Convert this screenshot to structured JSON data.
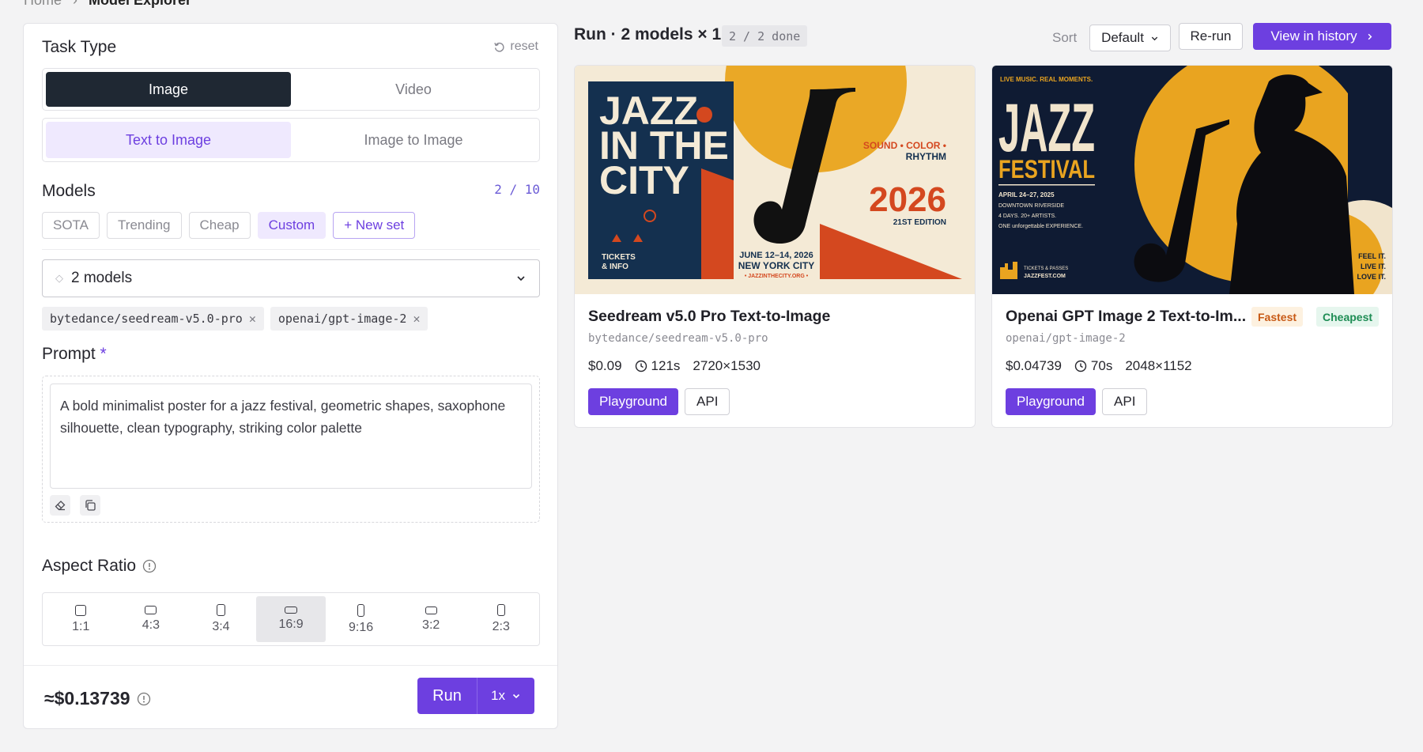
{
  "breadcrumb": {
    "home": "Home",
    "separator": "›",
    "current": "Model Explorer"
  },
  "task": {
    "title": "Task Type",
    "reset": "reset",
    "types": [
      "Image",
      "Video"
    ],
    "modes": [
      "Text to Image",
      "Image to Image"
    ]
  },
  "models": {
    "title": "Models",
    "counter": "2 / 10",
    "presets": [
      "SOTA",
      "Trending",
      "Cheap",
      "Custom",
      "+ New set"
    ],
    "select_label": "2 models",
    "selected": [
      "bytedance/seedream-v5.0-pro",
      "openai/gpt-image-2"
    ]
  },
  "prompt": {
    "title": "Prompt",
    "required": "*",
    "text": "A bold minimalist poster for a jazz festival, geometric shapes, saxophone silhouette, clean typography, striking color palette"
  },
  "aspect": {
    "title": "Aspect Ratio",
    "options": [
      "1:1",
      "4:3",
      "3:4",
      "16:9",
      "9:16",
      "3:2",
      "2:3"
    ],
    "selected": "16:9"
  },
  "footer": {
    "cost": "≈$0.13739",
    "run": "Run",
    "multiplier": "1x"
  },
  "run": {
    "title": "Run · 2 models × 1",
    "status": "2 / 2 done",
    "sort_label": "Sort",
    "sort_value": "Default",
    "rerun": "Re-run",
    "history": "View in history"
  },
  "results": [
    {
      "name": "Seedream v5.0 Pro Text-to-Image",
      "id": "bytedance/seedream-v5.0-pro",
      "price": "$0.09",
      "duration": "121s",
      "resolution": "2720×1530",
      "playground": "Playground",
      "api": "API",
      "poster": {
        "line1": "JAZZ",
        "line2": "IN THE",
        "line3": "CITY",
        "tickets1": "TICKETS",
        "tickets2": "& INFO",
        "tagline1": "SOUND • COLOR •",
        "tagline2": "RHYTHM",
        "year": "2026",
        "edition": "21ST EDITION",
        "date": "JUNE 12–14, 2026",
        "city": "NEW YORK CITY",
        "url": "• JAZZINTHECITY.ORG •"
      }
    },
    {
      "name": "Openai GPT Image 2 Text-to-Im...",
      "id": "openai/gpt-image-2",
      "price": "$0.04739",
      "duration": "70s",
      "resolution": "2048×1152",
      "badges": [
        "Fastest",
        "Cheapest"
      ],
      "playground": "Playground",
      "api": "API",
      "poster": {
        "top": "LIVE MUSIC. REAL MOMENTS.",
        "title1": "JAZZ",
        "title2": "FESTIVAL",
        "info1": "APRIL 24–27, 2025",
        "info2": "DOWNTOWN RIVERSIDE",
        "info3": "4 DAYS. 20+ ARTISTS.",
        "info4": "ONE unforgettable EXPERIENCE.",
        "tickets": "TICKETS & PASSES",
        "site": "JAZZFEST.COM",
        "feel1": "FEEL IT.",
        "feel2": "LIVE IT.",
        "feel3": "LOVE IT."
      }
    }
  ],
  "colors": {
    "accent": "#6d3fe0",
    "accent_soft": "#efe9fe",
    "dark": "#1f2833"
  }
}
